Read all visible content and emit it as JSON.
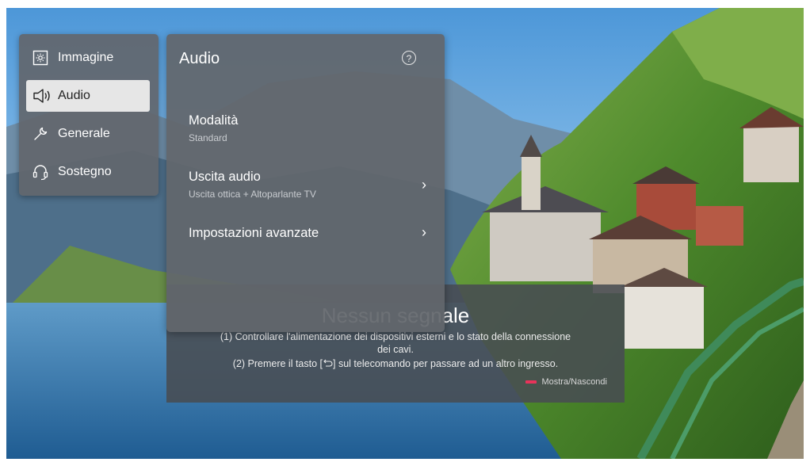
{
  "categories": [
    {
      "label": "Immagine",
      "icon": "picture-settings-icon",
      "active": false
    },
    {
      "label": "Audio",
      "icon": "speaker-icon",
      "active": true
    },
    {
      "label": "Generale",
      "icon": "wrench-icon",
      "active": false
    },
    {
      "label": "Sostegno",
      "icon": "headset-icon",
      "active": false
    }
  ],
  "panel": {
    "title": "Audio",
    "help_icon": "help-icon",
    "rows": [
      {
        "title": "Modalità",
        "subtitle": "Standard",
        "has_chevron": false
      },
      {
        "title": "Uscita audio",
        "subtitle": "Uscita ottica + Altoparlante TV",
        "has_chevron": true
      },
      {
        "title": "Impostazioni avanzate",
        "subtitle": "",
        "has_chevron": true
      }
    ]
  },
  "no_signal": {
    "title": "Nessun segnale",
    "line1": "(1) Controllare l'alimentazione dei dispositivi esterni e lo stato della connessione",
    "line2": "dei cavi.",
    "line3": "(2) Premere il tasto [",
    "input_icon": "input-source-icon",
    "line3_end": "] sul telecomando per passare ad un altro ingresso.",
    "toggle_label": "Mostra/Nascondi",
    "toggle_color": "#e8335a"
  },
  "colors": {
    "accent": "#e8335a",
    "active_item": "#e6e6e6",
    "panel": "#62666c"
  }
}
